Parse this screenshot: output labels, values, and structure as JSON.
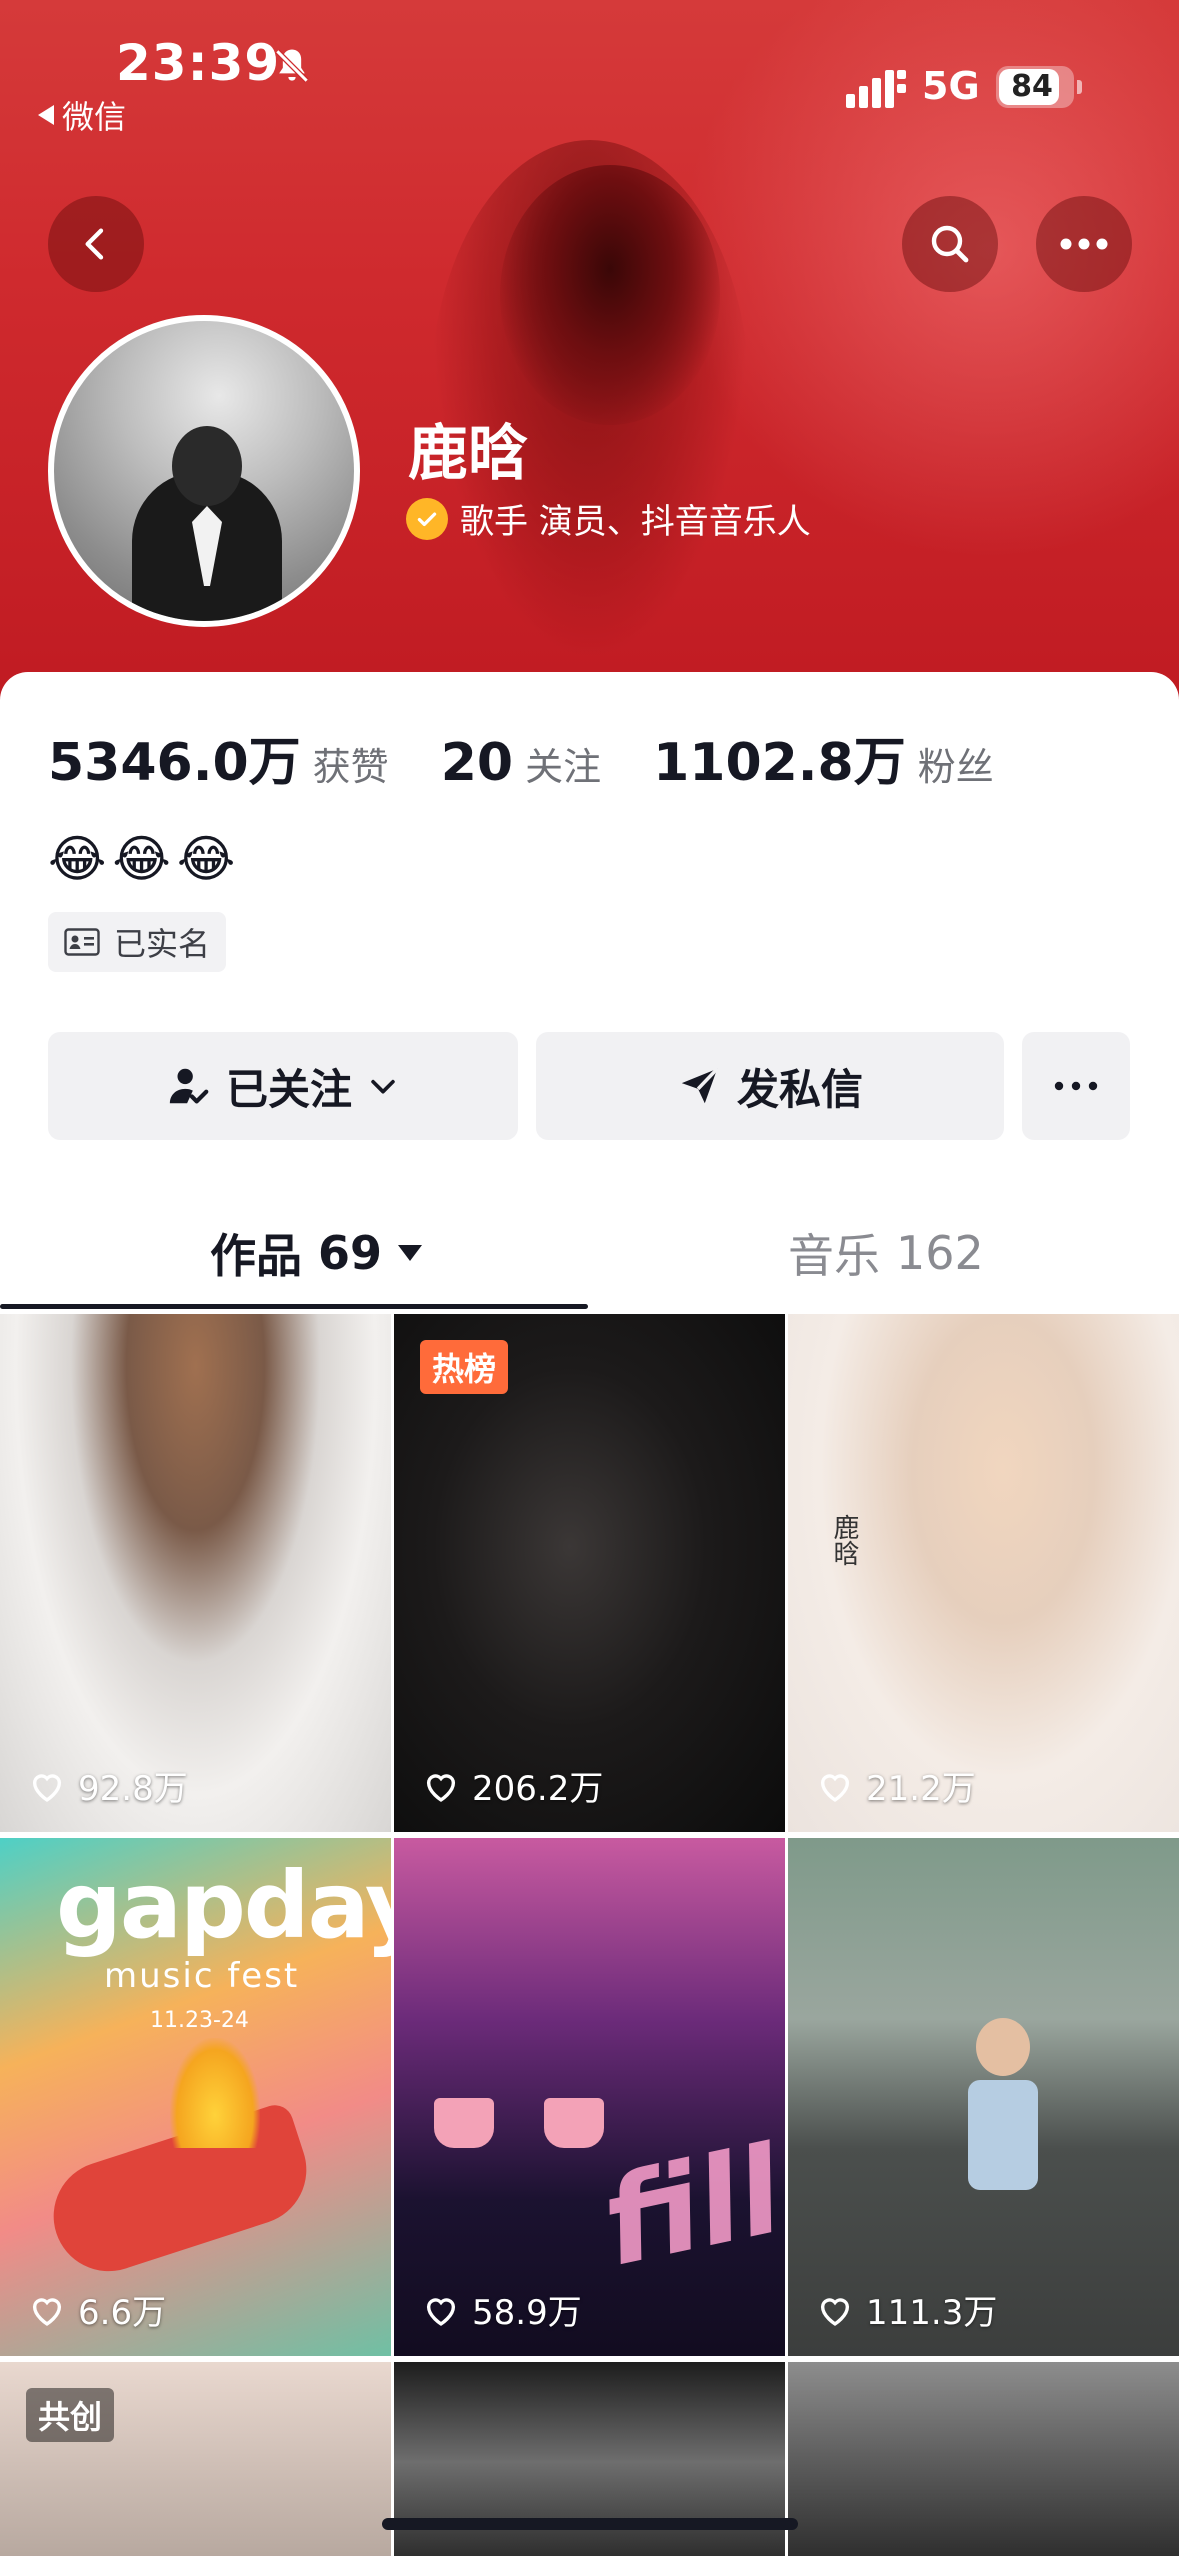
{
  "status_bar": {
    "time": "23:39",
    "back_app": "微信",
    "network": "5G",
    "battery": "84",
    "battery_level": 0.84,
    "icons": [
      "bell-muted-icon",
      "signal-icon",
      "battery-icon"
    ]
  },
  "header": {
    "nav_icons": [
      "back-icon",
      "search-icon",
      "more-icon"
    ],
    "background_color": "#cf2a2e"
  },
  "profile": {
    "name": "鹿晗",
    "verified_title": "歌手 演员、抖音音乐人",
    "verify_color": "#ffb627",
    "bio_emoji": "😂😂😂",
    "realname_label": "已实名"
  },
  "stats": [
    {
      "value": "5346.0万",
      "label": "获赞"
    },
    {
      "value": "20",
      "label": "关注"
    },
    {
      "value": "1102.8万",
      "label": "粉丝"
    }
  ],
  "actions": {
    "follow_label": "已关注",
    "message_label": "发私信",
    "more_icon": "more-icon"
  },
  "tabs": [
    {
      "label": "作品",
      "count": "69",
      "active": true
    },
    {
      "label": "音乐",
      "count": "162",
      "active": false
    }
  ],
  "videos": [
    {
      "likes": "92.8万"
    },
    {
      "likes": "206.2万",
      "tag": "热榜"
    },
    {
      "likes": "21.2万",
      "overlay_text": "鹿晗"
    },
    {
      "likes": "6.6万",
      "overlay_text": "gapday",
      "overlay_sub": "music fest",
      "overlay_date": "11.23-24"
    },
    {
      "likes": "58.9万",
      "overlay_text": "fill"
    },
    {
      "likes": "111.3万"
    },
    {
      "tag": "共创"
    },
    {},
    {}
  ]
}
